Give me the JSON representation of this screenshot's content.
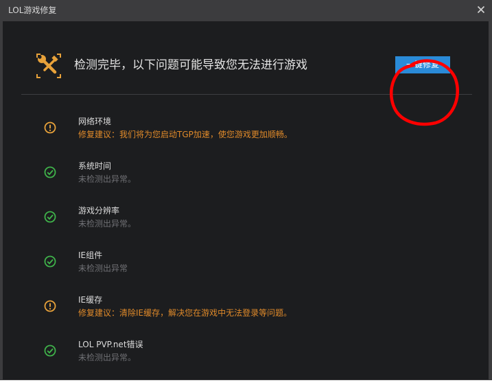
{
  "window": {
    "title": "LOL游戏修复"
  },
  "header": {
    "message": "检测完毕，以下问题可能导致您无法进行游戏",
    "fix_button_label": "一键修复",
    "icon": "wrench-icon"
  },
  "items": [
    {
      "name": "网络环境",
      "description": "修复建议：我们将为您启动TGP加速，使您游戏更加顺畅。",
      "status": "warning"
    },
    {
      "name": "系统时间",
      "description": "未检测出异常。",
      "status": "ok"
    },
    {
      "name": "游戏分辨率",
      "description": "未检测出异常。",
      "status": "ok"
    },
    {
      "name": "IE组件",
      "description": "未检测出异常",
      "status": "ok"
    },
    {
      "name": "IE缓存",
      "description": "修复建议：清除IE缓存，解决您在游戏中无法登录等问题。",
      "status": "warning"
    },
    {
      "name": "LOL PVP.net错误",
      "description": "未检测出异常。",
      "status": "ok"
    }
  ],
  "colors": {
    "warning": "#e8a23a",
    "ok": "#3fb24a",
    "accent": "#2a8bd8",
    "annotation": "#ff0000"
  }
}
